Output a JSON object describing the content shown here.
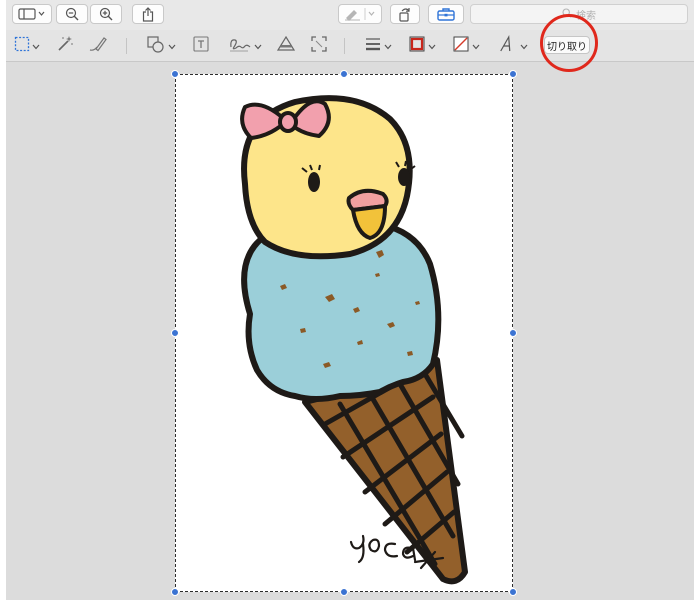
{
  "toolbar": {
    "search": {
      "placeholder": "検索"
    }
  },
  "markup_toolbar": {
    "crop_label": "切り取り",
    "colors": {
      "stroke": "#c8261b",
      "highlight_circle": "#e0281c",
      "handle": "#3b73d2"
    }
  },
  "icons": {
    "toolbar": [
      "sidebar-icon",
      "zoom-out-icon",
      "zoom-in-icon",
      "share-icon",
      "markup-pen-icon",
      "rotate-icon",
      "toolbox-icon",
      "search-icon"
    ],
    "markup": [
      "rectangular-selection-icon",
      "instant-alpha-icon",
      "sketch-icon",
      "shapes-icon",
      "text-box-icon",
      "signature-icon",
      "adjust-color-icon",
      "adjust-size-icon",
      "shape-style-icon",
      "border-color-icon",
      "fill-color-icon",
      "text-style-icon"
    ]
  },
  "image": {
    "signature_text": "YOCa"
  }
}
